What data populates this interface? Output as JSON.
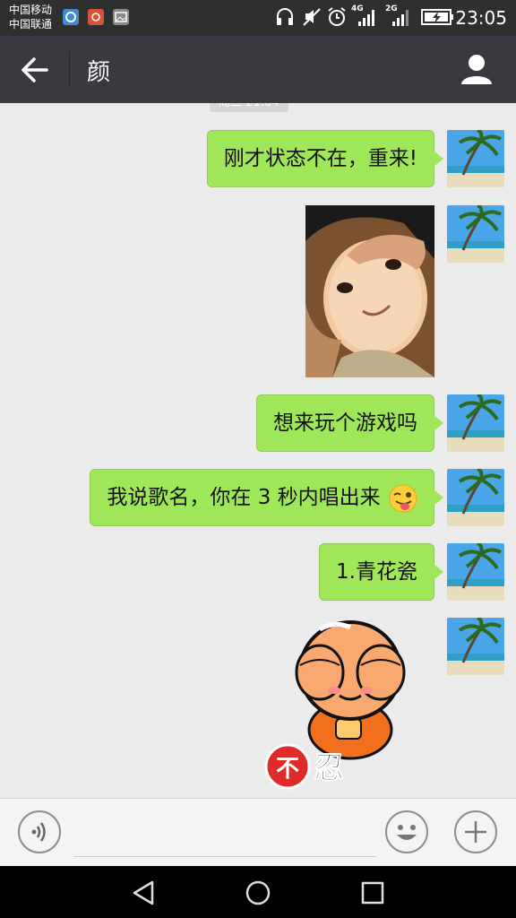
{
  "status_bar": {
    "carrier_1": "中国移动",
    "carrier_2": "中国联通",
    "network_1": "4G",
    "network_2": "2G",
    "time": "23:05",
    "icons": [
      "headphones-icon",
      "mute-icon",
      "alarm-icon",
      "signal-icon",
      "signal-icon",
      "battery-charging-icon"
    ]
  },
  "header": {
    "contact_name": "颜",
    "back_icon": "arrow-left-icon",
    "profile_icon": "person-icon"
  },
  "chat": {
    "timestamp": "周三 21:04",
    "messages": [
      {
        "type": "text",
        "sender": "me",
        "text": "刚才状态不在，重来!"
      },
      {
        "type": "image",
        "sender": "me",
        "content": "baby photo"
      },
      {
        "type": "text",
        "sender": "me",
        "text": "想来玩个游戏吗"
      },
      {
        "type": "text",
        "sender": "me",
        "text": "我说歌名，你在 3 秒内唱出来",
        "emoji": "winking-tongue-emoji"
      },
      {
        "type": "text",
        "sender": "me",
        "text": "1.青花瓷"
      },
      {
        "type": "sticker",
        "sender": "me",
        "caption": "不忍"
      }
    ]
  },
  "input_bar": {
    "voice_icon": "voice-icon",
    "text_value": "",
    "emoji_icon": "smiley-icon",
    "plus_icon": "plus-icon"
  },
  "nav_bar": {
    "icons": [
      "back-triangle-icon",
      "home-circle-icon",
      "recents-square-icon"
    ]
  },
  "colors": {
    "header_bg": "#393a3f",
    "chat_bg": "#ebebeb",
    "bubble_green": "#9fe759"
  }
}
